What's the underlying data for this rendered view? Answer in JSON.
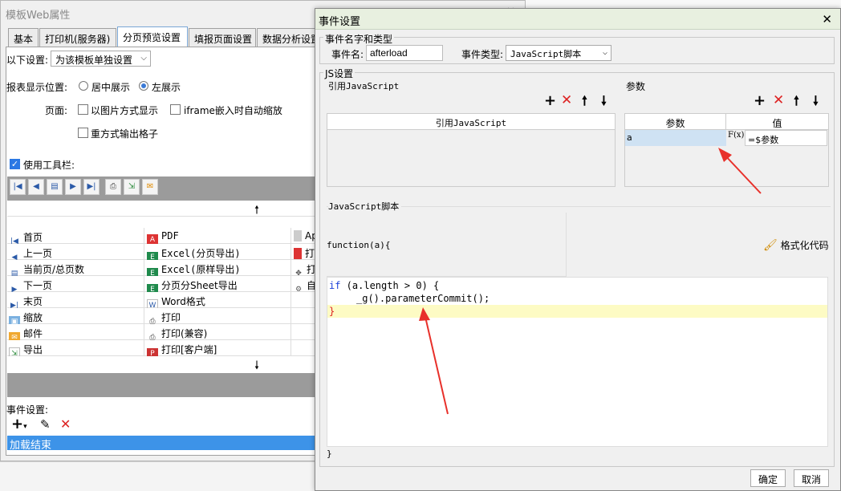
{
  "background_window": {
    "title": "模板Web属性",
    "tabs": [
      "基本",
      "打印机(服务器)",
      "分页预览设置",
      "填报页面设置",
      "数据分析设置"
    ],
    "settings_label": "以下设置:",
    "settings_value": "为该模板单独设置",
    "report_position_label": "报表显示位置:",
    "position_center": "居中展示",
    "position_left": "左展示",
    "page_label": "页面:",
    "image_display": "以图片方式显示",
    "iframe_scale": "iframe嵌入时自动缩放",
    "redraw_cells": "重方式输出格子",
    "use_toolbar": "使用工具栏:",
    "toolbar_items": [
      [
        "首页",
        "PDF",
        "Ap"
      ],
      [
        "上一页",
        "Excel(分页导出)",
        "打"
      ],
      [
        "当前页/总页数",
        "Excel(原样导出)",
        "打"
      ],
      [
        "下一页",
        "分页分Sheet导出",
        "自"
      ],
      [
        "末页",
        "Word格式",
        ""
      ],
      [
        "缩放",
        "打印",
        ""
      ],
      [
        "邮件",
        "打印(兼容)",
        ""
      ],
      [
        "导出",
        "打印[客户端]",
        ""
      ]
    ],
    "event_settings_label": "事件设置:",
    "event_item": "加载结束"
  },
  "dialog": {
    "title": "事件设置",
    "name_group": "事件名字和类型",
    "event_name_label": "事件名:",
    "event_name_value": "afterload",
    "event_type_label": "事件类型:",
    "event_type_value": "JavaScript脚本",
    "js_group": "JS设置",
    "ref_js_label": "引用JavaScript",
    "ref_js_column": "引用JavaScript",
    "params_label": "参数",
    "param_col": "参数",
    "value_col": "值",
    "param_name": "a",
    "param_value": "=$参数",
    "fx_label": "F(x)",
    "script_label": "JavaScript脚本",
    "function_header": "function(a){",
    "format_code": "格式化代码",
    "code_if": "if",
    "code_cond": " (a.length > 0) {",
    "code_call": "_g().parameterCommit();",
    "code_close_inner": "}",
    "code_close_outer": "}",
    "ok": "确定",
    "cancel": "取消"
  },
  "colors": {
    "accent": "#2b78e4",
    "highlight_line": "#fdfbc4",
    "param_cell": "#cfe2f3",
    "arrow": "#e8302a"
  }
}
